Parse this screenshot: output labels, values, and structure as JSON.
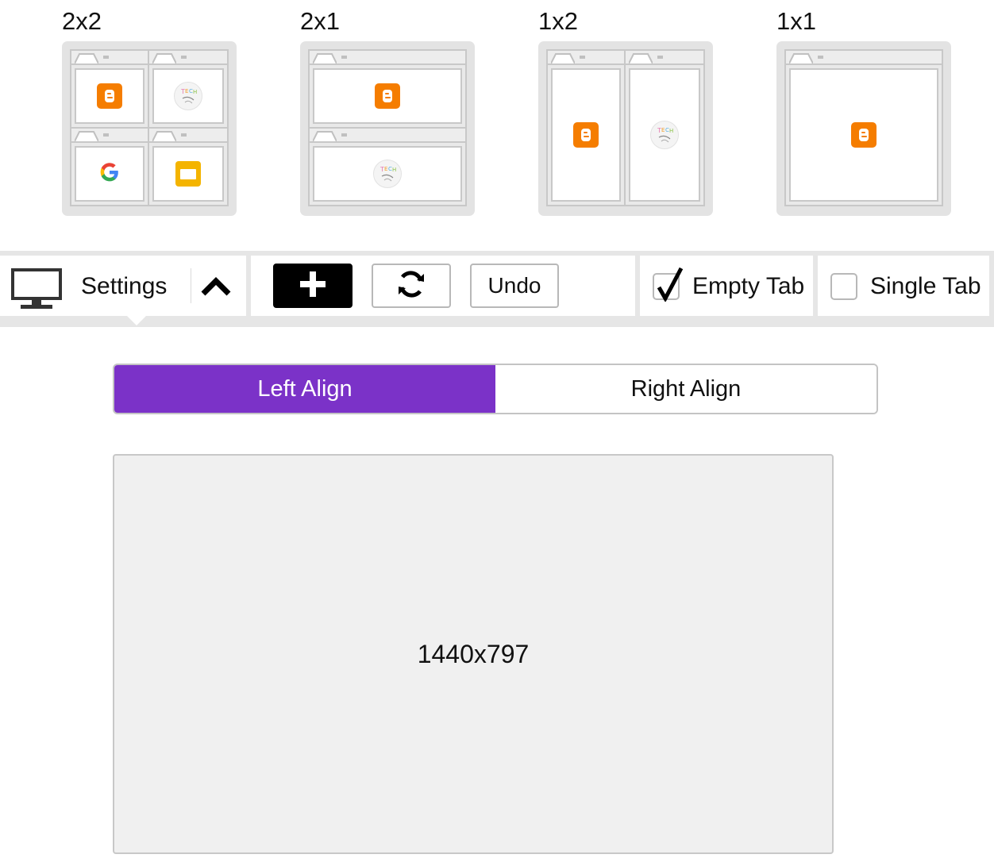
{
  "layouts": [
    {
      "id": "2x2",
      "label": "2x2"
    },
    {
      "id": "2x1",
      "label": "2x1"
    },
    {
      "id": "1x2",
      "label": "1x2"
    },
    {
      "id": "1x1",
      "label": "1x1"
    }
  ],
  "pane_icons": {
    "2x2": [
      "blogger-icon",
      "tech-logo-icon",
      "google-icon",
      "google-slides-icon"
    ],
    "2x1": [
      "blogger-icon",
      "tech-logo-icon"
    ],
    "1x2": [
      "blogger-icon",
      "tech-logo-icon"
    ],
    "1x1": [
      "blogger-icon"
    ]
  },
  "toolbar": {
    "display_icon": "monitor-icon",
    "settings_label": "Settings",
    "collapse_icon": "chevron-up-icon",
    "add_icon": "plus-icon",
    "refresh_icon": "refresh-icon",
    "undo_label": "Undo",
    "empty_tab": {
      "label": "Empty Tab",
      "checked": true
    },
    "single_tab": {
      "label": "Single Tab",
      "checked": false
    }
  },
  "alignment": {
    "left_label": "Left Align",
    "right_label": "Right Align",
    "selected": "left"
  },
  "preview": {
    "resolution_label": "1440x797"
  },
  "colors": {
    "accent_purple": "#7b32c8",
    "blogger_orange": "#f57d00",
    "slides_yellow": "#f4b400",
    "toolbar_bg": "#e6e6e6",
    "preview_bg": "#f0f0f0"
  }
}
